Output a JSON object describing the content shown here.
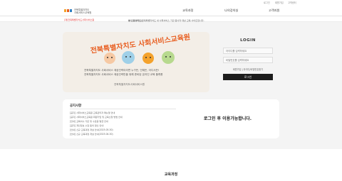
{
  "topbar": {
    "links": [
      "로그인",
      "회원가입",
      "고객센터"
    ]
  },
  "header": {
    "logo_line1": "전북특별자치도",
    "logo_line2": "사회서비스교육원",
    "nav": [
      "교육과정",
      "나의강의실",
      "고객지원"
    ]
  },
  "notice_bar": {
    "prefix": "본 교육사이트는 ",
    "highlight": "(재)전북특별자치도사회서비스원",
    "suffix": "에서 운영하는 전북특별자치도 내 사회서비스 기관 종사자 대상 교육 사이트입니다."
  },
  "banner": {
    "title": "전북특별자치도 사회서비스교육원",
    "line1": "전북특별자치도 사회서비스 제공인력이라면 누구든, 언제든, 어디서든!",
    "line2": "전북특별자치도 사회서비스 제공인력만을 위해 준비된 온라인 교육 플랫폼",
    "logo_text": "전북특별자치도사회서비스원"
  },
  "login": {
    "title": "LOGIN",
    "id_placeholder": "아이디를 입력하세요",
    "pw_placeholder": "비밀번호를 입력하세요",
    "find": "회원가입 | 아이디/비밀번호찾기",
    "button": "로그인"
  },
  "notice_board": {
    "title": "공지사항",
    "more": "MORE+",
    "items": [
      "[공지] 사회서비스교육원 교육관리자 매뉴얼 안내",
      "[공지] 사회서비스교육원 회원가입 및 교육신청 방법 안내",
      "[안내] 교육이수 기준 및 수료증 발급 안내",
      "[공지] 개인정보 수집 동의 갱신 안내",
      "[안내] 신규 교육과정 개설 안내(2025.05.30)",
      "[안내] 신규 교육과정 개설 안내(2025.04.30)"
    ]
  },
  "mystudy": {
    "message": "로그인 후 이용가능합니다."
  },
  "footer": {
    "section_title": "교육과정"
  },
  "colors": {
    "accent": "#e85d1f",
    "dark_button": "#1c1c1c",
    "highlight": "#dd3333"
  }
}
